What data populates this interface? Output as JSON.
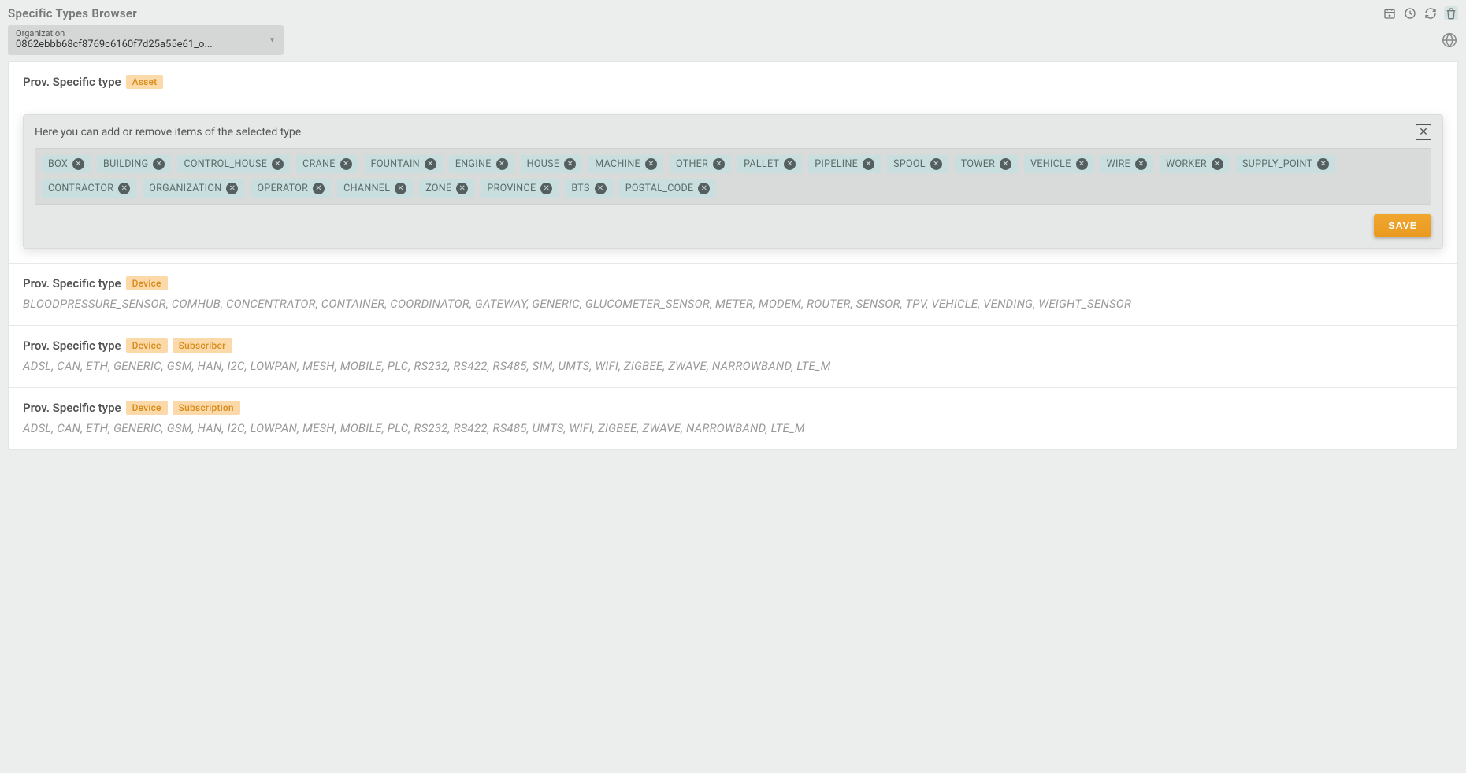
{
  "header": {
    "title": "Specific Types Browser",
    "icons": [
      "calendar-add-icon",
      "clock-icon",
      "refresh-icon",
      "trash-icon"
    ]
  },
  "org_selector": {
    "label": "Organization",
    "value": "0862ebbb68cf8769c6160f7d25a55e61_o..."
  },
  "sections": [
    {
      "title": "Prov. Specific type",
      "badges": [
        "Asset"
      ],
      "expanded": true,
      "editor": {
        "hint": "Here you can add or remove items of the selected type",
        "chips": [
          "BOX",
          "BUILDING",
          "CONTROL_HOUSE",
          "CRANE",
          "FOUNTAIN",
          "ENGINE",
          "HOUSE",
          "MACHINE",
          "OTHER",
          "PALLET",
          "PIPELINE",
          "SPOOL",
          "TOWER",
          "VEHICLE",
          "WIRE",
          "WORKER",
          "SUPPLY_POINT",
          "CONTRACTOR",
          "ORGANIZATION",
          "OPERATOR",
          "CHANNEL",
          "ZONE",
          "PROVINCE",
          "BTS",
          "POSTAL_CODE"
        ],
        "save_label": "SAVE"
      }
    },
    {
      "title": "Prov. Specific type",
      "badges": [
        "Device"
      ],
      "expanded": false,
      "items_text": "BLOODPRESSURE_SENSOR, COMHUB, CONCENTRATOR, CONTAINER, COORDINATOR, GATEWAY, GENERIC, GLUCOMETER_SENSOR, METER, MODEM, ROUTER, SENSOR, TPV, VEHICLE, VENDING, WEIGHT_SENSOR"
    },
    {
      "title": "Prov. Specific type",
      "badges": [
        "Device",
        "Subscriber"
      ],
      "expanded": false,
      "items_text": "ADSL, CAN, ETH, GENERIC, GSM, HAN, I2C, LOWPAN, MESH, MOBILE, PLC, RS232, RS422, RS485, SIM, UMTS, WIFI, ZIGBEE, ZWAVE, NARROWBAND, LTE_M"
    },
    {
      "title": "Prov. Specific type",
      "badges": [
        "Device",
        "Subscription"
      ],
      "expanded": false,
      "items_text": "ADSL, CAN, ETH, GENERIC, GSM, HAN, I2C, LOWPAN, MESH, MOBILE, PLC, RS232, RS422, RS485, UMTS, WIFI, ZIGBEE, ZWAVE, NARROWBAND, LTE_M"
    }
  ]
}
